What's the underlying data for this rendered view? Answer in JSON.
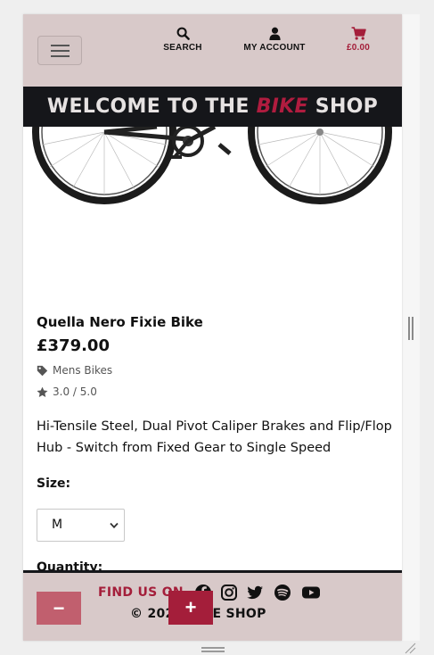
{
  "header": {
    "search_label": "SEARCH",
    "account_label": "MY ACCOUNT",
    "cart_total": "£0.00",
    "banner_prefix": "WELCOME TO THE ",
    "banner_accent": "BIKE",
    "banner_suffix": " SHOP"
  },
  "product": {
    "name": "Quella Nero Fixie Bike",
    "price": "£379.00",
    "category": "Mens Bikes",
    "rating": "3.0 / 5.0",
    "description": "Hi-Tensile Steel, Dual Pivot Caliper Brakes and Flip/Flop Hub - Switch from Fixed Gear to Single Speed",
    "size_label": "Size:",
    "size_value": "M",
    "quantity_label": "Quantity:"
  },
  "footer": {
    "find_us": "FIND US ON",
    "copyright": "© 2021 BIKE SHOP",
    "minus_label": "−",
    "plus_label": "+"
  },
  "colors": {
    "header_bg": "#d8c9c9",
    "banner_bg": "#15161a",
    "accent": "#a41e3a",
    "minus_button": "#c15f6e"
  }
}
